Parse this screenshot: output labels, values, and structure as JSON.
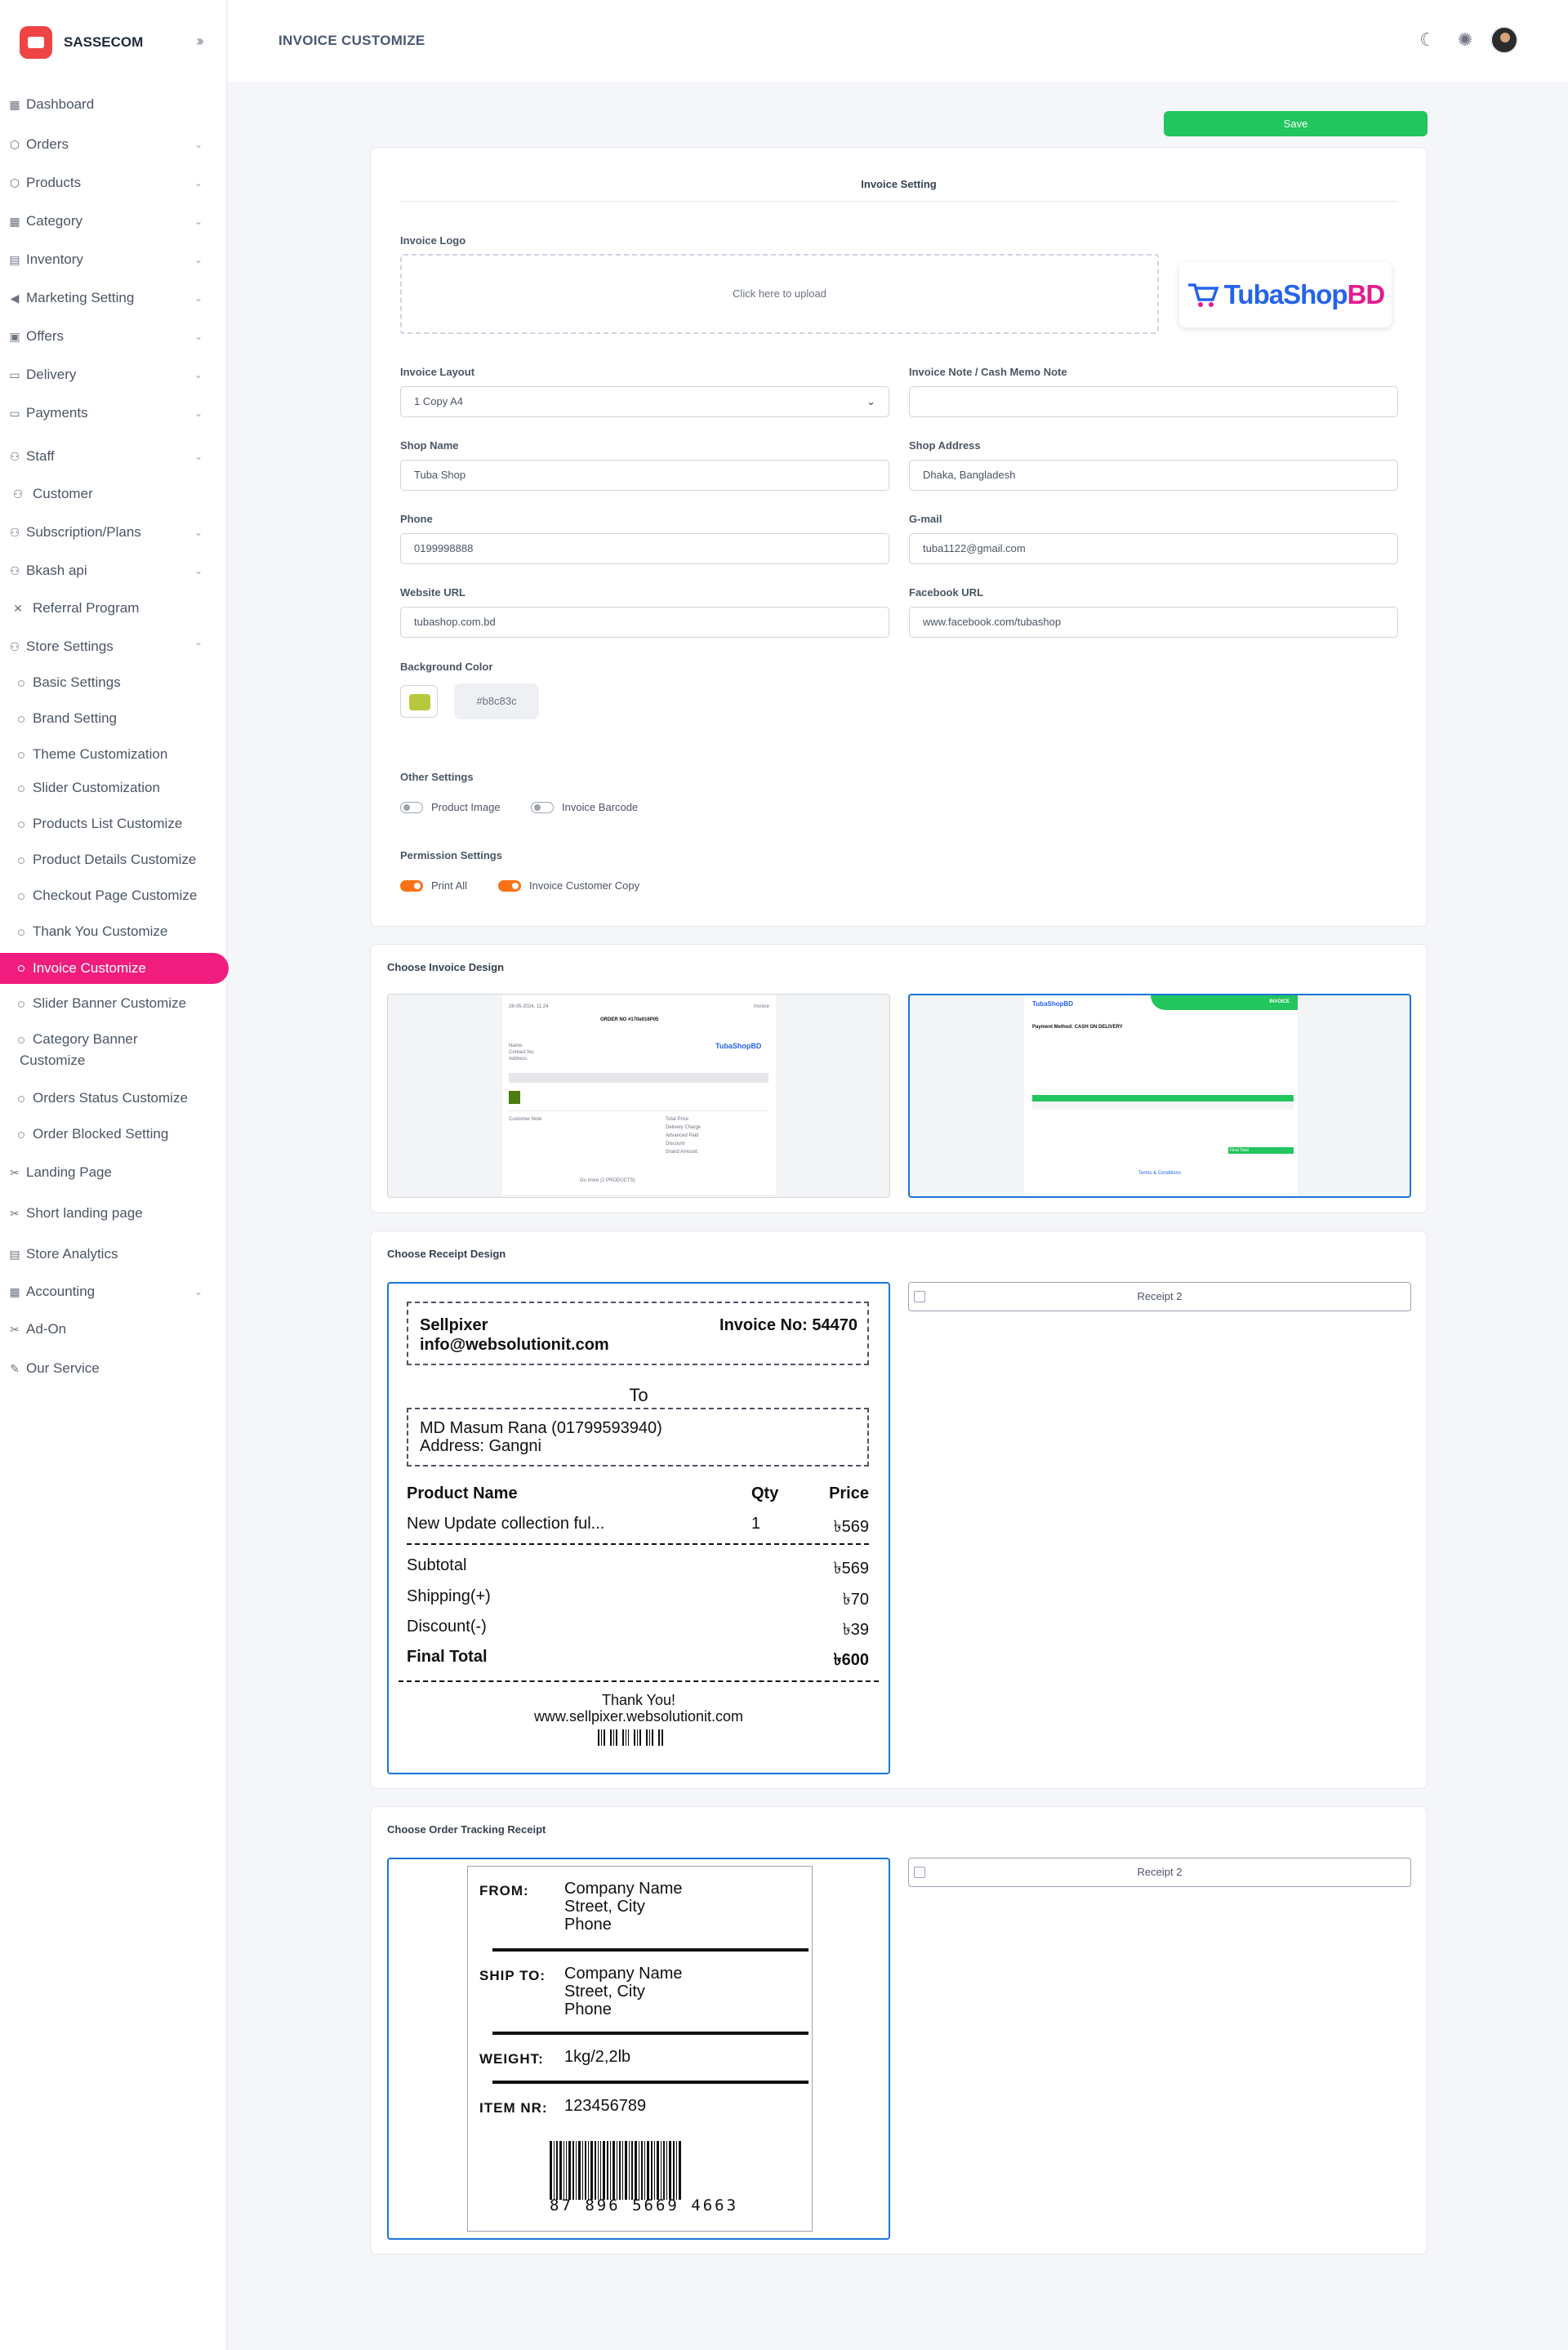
{
  "brand": {
    "name": "SASSECOM"
  },
  "sidebar": {
    "items": [
      {
        "label": "Dashboard",
        "icon": "grid-icon"
      },
      {
        "label": "Orders",
        "icon": "box-icon"
      },
      {
        "label": "Products",
        "icon": "cube-icon"
      },
      {
        "label": "Category",
        "icon": "category-icon"
      },
      {
        "label": "Inventory",
        "icon": "inventory-icon"
      },
      {
        "label": "Marketing Setting",
        "icon": "megaphone-icon"
      },
      {
        "label": "Offers",
        "icon": "gift-icon"
      },
      {
        "label": "Delivery",
        "icon": "truck-icon"
      },
      {
        "label": "Payments",
        "icon": "card-icon"
      },
      {
        "label": "Staff",
        "icon": "users-icon"
      },
      {
        "label": "Customer",
        "icon": "customer-icon"
      },
      {
        "label": "Subscription/Plans",
        "icon": "plans-icon"
      },
      {
        "label": "Bkash api",
        "icon": "api-icon"
      },
      {
        "label": "Referral Program",
        "icon": "referral-icon"
      },
      {
        "label": "Store Settings",
        "icon": "settings-icon"
      }
    ],
    "store_settings_sub": [
      "Basic Settings",
      "Brand Setting",
      "Theme Customization",
      "Slider Customization",
      "Products List Customize",
      "Product Details Customize",
      "Checkout Page Customize",
      "Thank You Customize",
      "Invoice Customize",
      "Slider Banner Customize",
      "Category Banner",
      "Customize",
      "Orders Status Customize",
      "Order Blocked Setting"
    ],
    "bottom": [
      {
        "label": "Landing Page"
      },
      {
        "label": "Short landing page"
      },
      {
        "label": "Store Analytics"
      },
      {
        "label": "Accounting"
      },
      {
        "label": "Ad-On"
      },
      {
        "label": "Our Service"
      }
    ]
  },
  "header": {
    "title": "INVOICE CUSTOMIZE"
  },
  "toolbar": {
    "save_label": "Save"
  },
  "invoice_setting": {
    "title": "Invoice Setting",
    "logo_label": "Invoice Logo",
    "upload_text": "Click here to upload",
    "logo_text_a": "TubaShop",
    "logo_text_b": "BD",
    "layout_label": "Invoice Layout",
    "layout_value": "1 Copy A4",
    "note_label": "Invoice Note / Cash Memo Note",
    "note_value": "",
    "shop_name_label": "Shop Name",
    "shop_name_value": "Tuba Shop",
    "shop_address_label": "Shop Address",
    "shop_address_value": "Dhaka, Bangladesh",
    "phone_label": "Phone",
    "phone_value": "0199998888",
    "gmail_label": "G-mail",
    "gmail_value": "tuba1122@gmail.com",
    "website_label": "Website URL",
    "website_value": "tubashop.com.bd",
    "facebook_label": "Facebook URL",
    "facebook_value": "www.facebook.com/tubashop",
    "bg_label": "Background Color",
    "bg_value": "#b8c83c",
    "other_label": "Other Settings",
    "product_image_label": "Product Image",
    "invoice_barcode_label": "Invoice Barcode",
    "perm_label": "Permission Settings",
    "print_all_label": "Print All",
    "customer_copy_label": "Invoice Customer Copy",
    "colors": {
      "accent": "#f01d7e",
      "save": "#22c55e",
      "toggle_on": "#f97316",
      "selected_border": "#1d74d8"
    }
  },
  "invoice_design": {
    "title": "Choose Invoice Design",
    "d1": {
      "order": "ORDER NO #170e016P05",
      "total": "Grand Amount:",
      "footer": "Go more (2 PRODUCTS)"
    },
    "d2": {
      "header": "INVOICE",
      "payment": "Payment Method: CASH ON DELIVERY",
      "total": "Final Total"
    }
  },
  "receipt_design": {
    "title": "Choose Receipt Design",
    "shop": "Sellpixer",
    "email": "info@websolutionit.com",
    "invoice_no": "Invoice No: 54470",
    "to": "To",
    "customer": "MD Masum Rana (01799593940)",
    "address": "Address: Gangni",
    "col_product": "Product Name",
    "col_qty": "Qty",
    "col_price": "Price",
    "item_name": "New Update collection ful...",
    "item_qty": "1",
    "item_price": "৳569",
    "subtotal_label": "Subtotal",
    "subtotal": "৳569",
    "shipping_label": "Shipping(+)",
    "shipping": "৳70",
    "discount_label": "Discount(-)",
    "discount": "৳39",
    "final_label": "Final Total",
    "final": "৳600",
    "thanks": "Thank You!",
    "site": "www.sellpixer.websolutionit.com",
    "receipt2": "Receipt 2"
  },
  "tracking": {
    "title": "Choose Order Tracking Receipt",
    "from_label": "FROM:",
    "from_l1": "Company Name",
    "from_l2": "Street, City",
    "from_l3": "Phone",
    "shipto_label": "SHIP TO:",
    "shipto_l1": "Company Name",
    "shipto_l2": "Street, City",
    "shipto_l3": "Phone",
    "weight_label": "WEIGHT:",
    "weight": "1kg/2,2lb",
    "item_label": "ITEM NR:",
    "item": "123456789",
    "barcode_digits": "87 896 5669 4663",
    "receipt2": "Receipt 2"
  }
}
